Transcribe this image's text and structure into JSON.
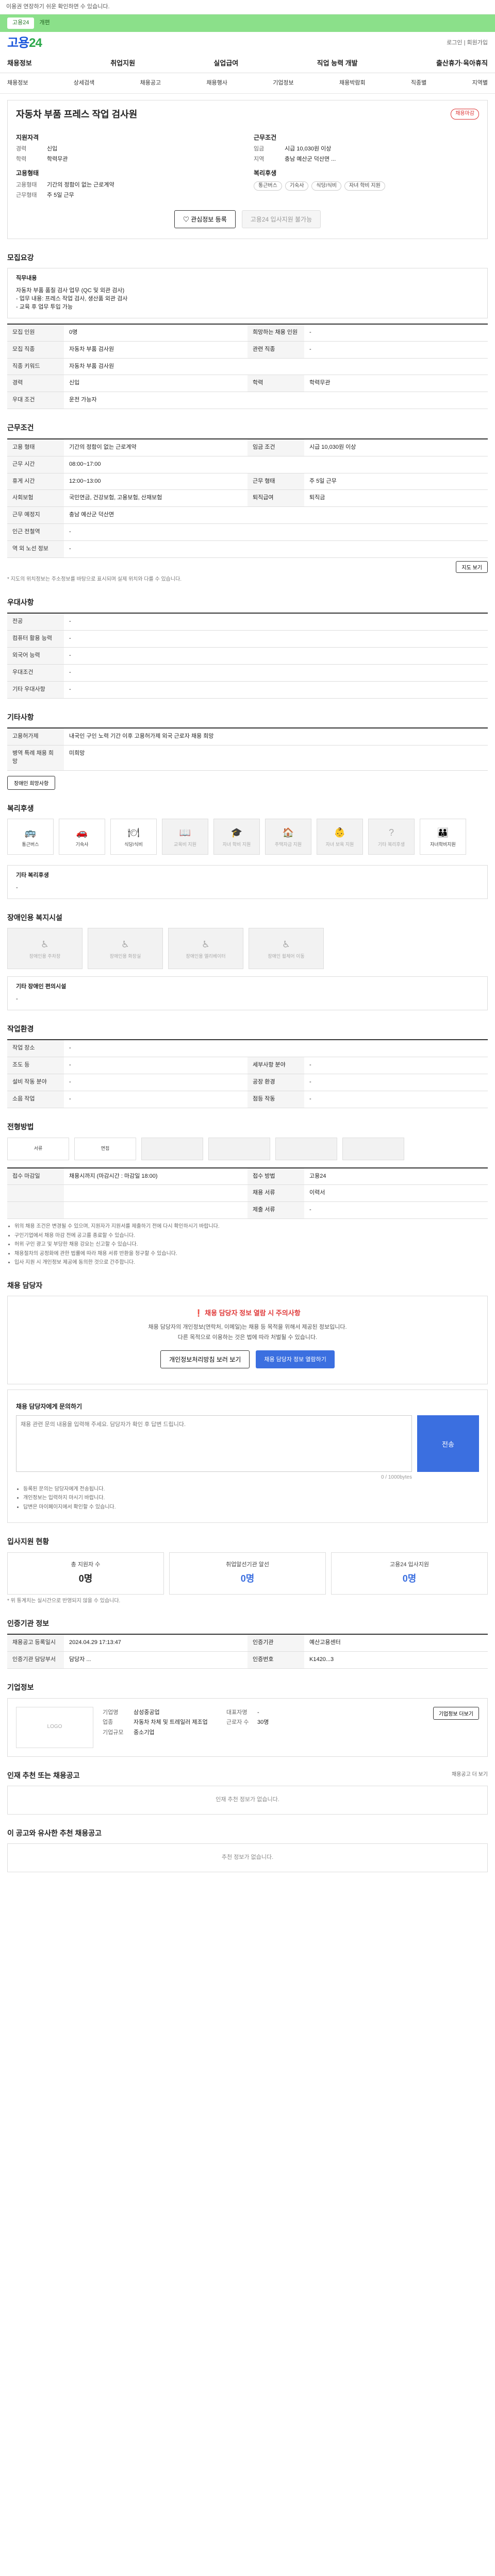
{
  "topbar": {
    "text": "이용권 연장하기 쉬운 확인하면 수 있습니다."
  },
  "greenbar": {
    "pill": "고용24",
    "text": "개편"
  },
  "brand": {
    "logo_main": "고용",
    "logo_num": "24",
    "links": "로그인 | 회원가입"
  },
  "gnb": [
    "채용정보",
    "취업지원",
    "실업급여",
    "직업 능력 개발",
    "출산휴가·육아휴직"
  ],
  "subnav": [
    "채용정보",
    "상세검색",
    "채용공고",
    "채용행사",
    "기업정보",
    "채용박람회",
    "직종별",
    "지역별"
  ],
  "job": {
    "title": "자동차 부품 프레스 작업 검사원",
    "badge": "채용마감",
    "left_heading": "지원자격",
    "left": [
      {
        "k": "경력",
        "v": "신입"
      },
      {
        "k": "학력",
        "v": "학력무관"
      }
    ],
    "left2_heading": "고용형태",
    "left2": [
      {
        "k": "고용형태",
        "v": "기간의 정함이 없는 근로계약"
      },
      {
        "k": "근무형태",
        "v": "주 5일 근무"
      }
    ],
    "right_heading": "근무조건",
    "right": [
      {
        "k": "임금",
        "v": "시급 10,030원 이상"
      },
      {
        "k": "지역",
        "v": "충남 예산군 덕산면 ..."
      }
    ],
    "right2_heading": "복리후생",
    "tags": [
      "통근버스",
      "기숙사",
      "식당/식비",
      "자녀 학비 지원"
    ],
    "btn_save": "관심정보 등록",
    "btn_apply": "고용24 입사지원 불가능"
  },
  "recruit": {
    "title": "모집요강",
    "desc_t": "직무내용",
    "desc": [
      "자동차 부품 품질 검사 업무 (QC 및 외관 검사)",
      "- 업무 내용: 프레스 작업 검사, 생산품 외관 검사",
      "- 교육 후 업무 투입 가능"
    ],
    "rows": [
      [
        "모집 인원",
        "0명",
        "희망하는 채용 인원",
        "-"
      ],
      [
        "모집 직종",
        "자동차 부품 검사원",
        "관련 직종",
        "-"
      ],
      [
        "직종 키워드",
        "자동차 부품 검사원",
        "",
        ""
      ],
      [
        "경력",
        "신입",
        "학력",
        "학력무관"
      ],
      [
        "우대 조건",
        "운전 가능자",
        "",
        ""
      ]
    ]
  },
  "conditions": {
    "title": "근무조건",
    "rows": [
      [
        "고용 형태",
        "기간의 정함이 없는 근로계약",
        "임금 조건",
        "시급 10,030원 이상"
      ],
      [
        "근무 시간",
        "08:00~17:00",
        "",
        ""
      ],
      [
        "휴게 시간",
        "12:00~13:00",
        "근무 형태",
        "주 5일 근무"
      ],
      [
        "사회보험",
        "국민연금, 건강보험, 고용보험, 산재보험",
        "퇴직급여",
        "퇴직금"
      ],
      [
        "근무 예정지",
        "충남 예산군 덕산면",
        "",
        ""
      ],
      [
        "인근 전철역",
        "-",
        "",
        ""
      ],
      [
        "역 외 노선 정보",
        "-",
        "",
        ""
      ]
    ],
    "map_btn": "지도 보기",
    "note": "* 지도의 위치정보는 주소정보를 바탕으로 표시되며 실제 위치와 다를 수 있습니다."
  },
  "preferred": {
    "title": "우대사항",
    "rows": [
      [
        "전공",
        "-"
      ],
      [
        "컴퓨터 활용 능력",
        "-"
      ],
      [
        "외국어 능력",
        "-"
      ],
      [
        "우대조건",
        "-"
      ],
      [
        "기타 우대사항",
        "-"
      ]
    ]
  },
  "etc": {
    "title": "기타사항",
    "rows": [
      [
        "고용허가제",
        "내국인 구인 노력 기간 이후 고용허가제 외국 근로자 채용 희망"
      ],
      [
        "병역 특례 채용 희망",
        "미희망"
      ]
    ],
    "btn": "장애인 희망사항"
  },
  "welfare": {
    "title": "복리후생",
    "items": [
      {
        "label": "통근버스",
        "on": true,
        "icon": "bus-icon",
        "glyph": "🚌"
      },
      {
        "label": "기숙사",
        "on": true,
        "icon": "car-icon",
        "glyph": "🚗"
      },
      {
        "label": "식당/식비",
        "on": true,
        "icon": "meal-icon",
        "glyph": "🍽"
      },
      {
        "label": "교육비 지원",
        "on": false,
        "icon": "education-icon",
        "glyph": "📖"
      },
      {
        "label": "자녀 학비 지원",
        "on": false,
        "icon": "graduation-icon",
        "glyph": "🎓"
      },
      {
        "label": "주택자금 지원",
        "on": false,
        "icon": "house-icon",
        "glyph": "🏠"
      },
      {
        "label": "자녀 보육 지원",
        "on": false,
        "icon": "childcare-icon",
        "glyph": "👶"
      },
      {
        "label": "기타 복리후생",
        "on": false,
        "icon": "help-icon",
        "glyph": "?"
      },
      {
        "label": "자녀학비지원",
        "on": true,
        "icon": "family-icon",
        "glyph": "👪"
      }
    ],
    "etc_t": "기타 복리후생",
    "etc_v": "-"
  },
  "disabled": {
    "title": "장애인용 복지시설",
    "items": [
      "장애인용 주차장",
      "장애인용 화장실",
      "장애인용 엘리베이터",
      "장애인 휠체어 이동"
    ],
    "etc_t": "기타 장애인 편의시설",
    "etc_v": "-"
  },
  "env": {
    "title": "작업환경",
    "rows": [
      [
        "작업 장소",
        "-",
        "",
        ""
      ],
      [
        "조도 등",
        "-",
        "세부사항 분야",
        "-"
      ],
      [
        "설비 작동 분야",
        "-",
        "공장 환경",
        "-"
      ],
      [
        "소음 작업",
        "-",
        "점등 작동",
        "-"
      ]
    ]
  },
  "apply": {
    "title": "전형방법",
    "steps": [
      "서류",
      "면접",
      "",
      "",
      "",
      ""
    ],
    "rows": [
      [
        "접수 마감일",
        "채용시까지 (마감시간 : 마감일 18:00)",
        "접수 방법",
        "고용24"
      ],
      [
        "",
        "",
        "채용 서류",
        "이력서"
      ],
      [
        "",
        "",
        "제출 서류",
        "-"
      ]
    ],
    "notes": [
      "위의 채용 조건은 변경될 수 있으며, 지원자가 지원서를 제출하기 전에 다시 확인하시기 바랍니다.",
      "구인기업에서 채용 마감 전에 공고를 종료할 수 있습니다.",
      "허위 구인 광고 및 부당한 채용 강요는 신고할 수 있습니다.",
      "채용절차의 공정화에 관한 법률에 따라 채용 서류 반환을 청구할 수 있습니다.",
      "입사 지원 시 개인정보 제공에 동의한 것으로 간주합니다."
    ]
  },
  "contact": {
    "title": "채용 담당자",
    "warn": "채용 담당자 정보 열람 시 주의사항",
    "p1": "채용 담당자의 개인정보(연락처, 이메일)는 채용 등 목적을 위해서 제공된 정보입니다.",
    "p2": "다른 목적으로 이용하는 것은 법에 따라 처벌될 수 있습니다.",
    "btn1": "개인정보처리방침 보러 보기",
    "btn2": "채용 담당자 정보 열람하기"
  },
  "ask": {
    "title": "채용 담당자에게 문의하기",
    "placeholder": "채용 관련 문의 내용을 입력해 주세요. 담당자가 확인 후 답변 드립니다.",
    "send": "전송",
    "counter": "0 / 1000bytes",
    "notes": [
      "등록된 문의는 담당자에게 전송됩니다.",
      "개인정보는 입력하지 마시기 바랍니다.",
      "답변은 마이페이지에서 확인할 수 있습니다."
    ]
  },
  "stats": {
    "title": "입사지원 현황",
    "items": [
      {
        "l": "총 지원자 수",
        "v": "0명"
      },
      {
        "l": "취업알선기관 알선",
        "v": "0명"
      },
      {
        "l": "고용24 입사지원",
        "v": "0명"
      }
    ],
    "note": "* 위 통계치는 실시간으로 반영되지 않을 수 있습니다."
  },
  "info": {
    "title": "인증기관 정보",
    "rows": [
      [
        "채용공고 등록일시",
        "2024.04.29 17:13:47",
        "인증기관",
        "예산고용센터"
      ],
      [
        "인증기관 담당부서",
        "담당자 ...",
        "인증번호",
        "K1420...3"
      ]
    ]
  },
  "org": {
    "title": "기업정보",
    "logo": "LOGO",
    "rows": [
      [
        "기업명",
        "삼성중공업",
        "대표자명",
        "-"
      ],
      [
        "업종",
        "자동차 차체 및 트레일러 제조업",
        "근로자 수",
        "30명"
      ],
      [
        "기업규모",
        "중소기업",
        "",
        ""
      ]
    ],
    "more": "기업정보 더보기"
  },
  "other": {
    "title": "인재 추천 또는 채용공고",
    "more": "채용공고 더 보기",
    "empty": "인재 추천 정보가 없습니다."
  },
  "recommend": {
    "title": "이 공고와 유사한 추천 채용공고",
    "empty": "추천 정보가 없습니다."
  }
}
